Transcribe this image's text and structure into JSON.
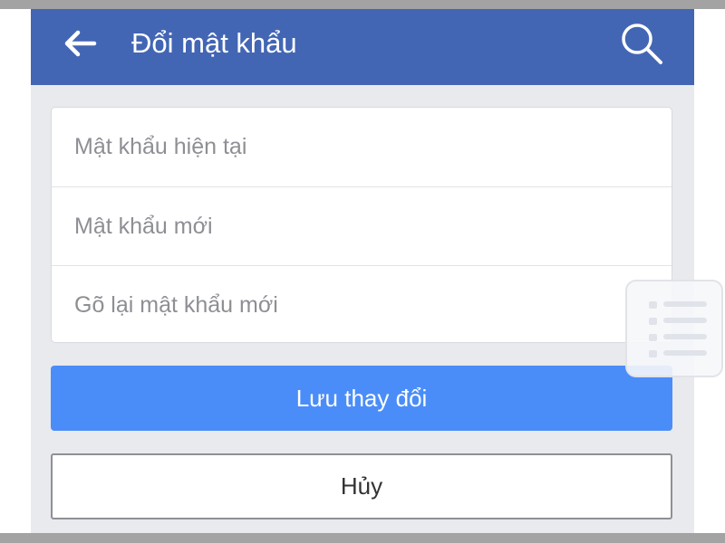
{
  "header": {
    "title": "Đổi mật khẩu",
    "back_icon": "arrow-left-icon",
    "search_icon": "search-icon",
    "background_color": "#4366b4"
  },
  "form": {
    "current_password": {
      "placeholder": "Mật khẩu hiện tại",
      "value": ""
    },
    "new_password": {
      "placeholder": "Mật khẩu mới",
      "value": ""
    },
    "confirm_password": {
      "placeholder": "Gõ lại mật khẩu mới",
      "value": ""
    }
  },
  "actions": {
    "save_label": "Lưu thay đổi",
    "save_color": "#4a8df8",
    "cancel_label": "Hủy"
  },
  "overlay": {
    "icon": "list-icon"
  }
}
